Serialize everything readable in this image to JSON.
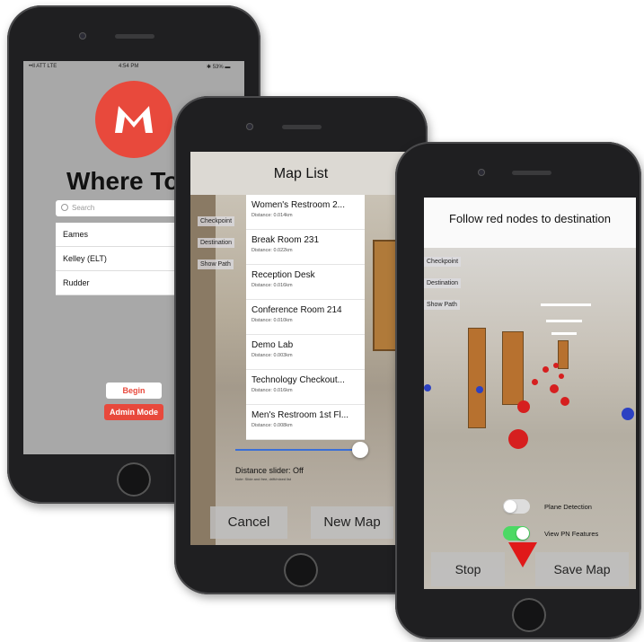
{
  "phone1": {
    "status": {
      "carrier": "••ll ATT LTE",
      "time": "4:54 PM",
      "battery": "✱ 53% ▬"
    },
    "app_title": "Where To",
    "search_placeholder": "Search",
    "list": [
      "Eames",
      "Kelley (ELT)",
      "Rudder"
    ],
    "begin_label": "Begin",
    "admin_label": "Admin Mode",
    "colors": {
      "brand": "#e8493c"
    }
  },
  "phone2": {
    "title": "Map List",
    "side_buttons": [
      "Checkpoint",
      "Destination",
      "Show Path"
    ],
    "items": [
      {
        "name": "Women's Restroom 2...",
        "distance": "Distance: 0.014km"
      },
      {
        "name": "Break Room 231",
        "distance": "Distance: 0.022km"
      },
      {
        "name": "Reception Desk",
        "distance": "Distance: 0.016km"
      },
      {
        "name": "Conference Room 214",
        "distance": "Distance: 0.010km"
      },
      {
        "name": "Demo Lab",
        "distance": "Distance: 0.003km"
      },
      {
        "name": "Technology Checkout...",
        "distance": "Distance: 0.016km"
      },
      {
        "name": "Men's Restroom 1st Fl...",
        "distance": "Distance: 0.008km"
      }
    ],
    "slider": {
      "label": "Distance slider: Off",
      "note": "Note: Slide and free, drift/mixed list",
      "value": 1.0
    },
    "cancel_label": "Cancel",
    "new_map_label": "New Map"
  },
  "phone3": {
    "instruction": "Follow red nodes to destination",
    "side_buttons": [
      "Checkpoint",
      "Destination",
      "Show Path"
    ],
    "toggle1_label": "Plane Detection",
    "toggle2_label": "View PN Features",
    "toggle1_on": false,
    "toggle2_on": true,
    "stop_label": "Stop",
    "save_label": "Save Map",
    "colors": {
      "node": "#d61f1f",
      "marker": "#2c41c2",
      "toggle_on": "#4cd964"
    }
  }
}
